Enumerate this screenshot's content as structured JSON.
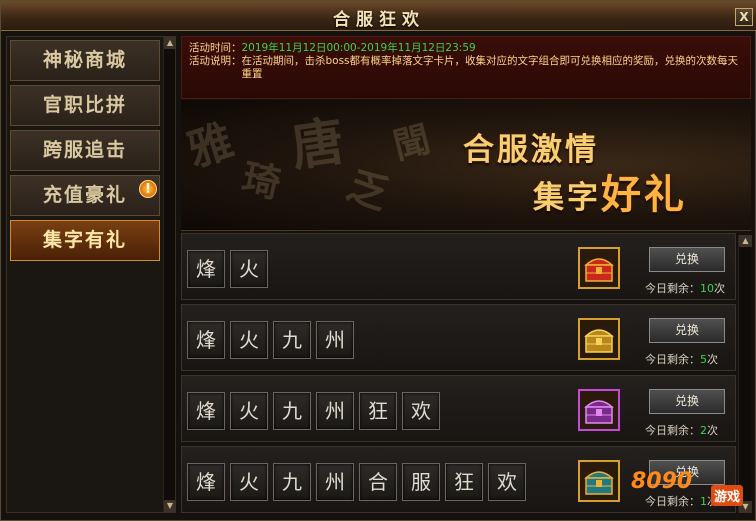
{
  "window": {
    "title": "合服狂欢",
    "close_label": "X"
  },
  "sidebar": {
    "items": [
      {
        "label": "神秘商城",
        "active": false,
        "badge": ""
      },
      {
        "label": "官职比拼",
        "active": false,
        "badge": ""
      },
      {
        "label": "跨服追击",
        "active": false,
        "badge": ""
      },
      {
        "label": "充值豪礼",
        "active": false,
        "badge": "!"
      },
      {
        "label": "集字有礼",
        "active": true,
        "badge": ""
      }
    ]
  },
  "info": {
    "time_label": "活动时间：",
    "time_value": "2019年11月12日00:00-2019年11月12日23:59",
    "desc_label": "活动说明：",
    "desc_value": "在活动期间，击杀boss都有概率掉落文字卡片，收集对应的文字组合即可兑换相应的奖励，兑换的次数每天重置"
  },
  "banner": {
    "line1": "合服激情",
    "line2_prefix": "集字",
    "line2_big": "好礼"
  },
  "rows": [
    {
      "chars": [
        "烽",
        "火"
      ],
      "icon": "red-treasure-icon",
      "button": "兑换",
      "remain_label": "今日剩余：",
      "remain_count": "10",
      "remain_unit": "次"
    },
    {
      "chars": [
        "烽",
        "火",
        "九",
        "州"
      ],
      "icon": "gold-chest-icon",
      "button": "兑换",
      "remain_label": "今日剩余：",
      "remain_count": "5",
      "remain_unit": "次"
    },
    {
      "chars": [
        "烽",
        "火",
        "九",
        "州",
        "狂",
        "欢"
      ],
      "icon": "purple-chest-icon",
      "button": "兑换",
      "remain_label": "今日剩余：",
      "remain_count": "2",
      "remain_unit": "次"
    },
    {
      "chars": [
        "烽",
        "火",
        "九",
        "州",
        "合",
        "服",
        "狂",
        "欢"
      ],
      "icon": "teal-chest-icon",
      "button": "兑换",
      "remain_label": "今日剩余：",
      "remain_count": "1",
      "remain_unit": "次"
    }
  ],
  "watermark": {
    "number": "8090",
    "text": "游戏"
  },
  "colors": {
    "accent": "#f5cf72",
    "count": "#39d64b",
    "active_tab": "#7a3f12"
  }
}
